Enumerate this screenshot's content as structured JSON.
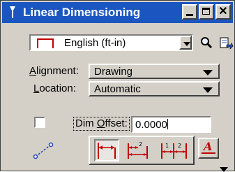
{
  "window": {
    "title": "Linear Dimensioning"
  },
  "titlebar": {
    "app_icon": "dimension-tool-icon",
    "minimize_icon": "minimize-icon",
    "maximize_icon": "maximize-icon",
    "close_glyph": "✕"
  },
  "units": {
    "selected": "English (ft-in)",
    "icon": "unit-bracket-icon",
    "search_icon": "magnifier-icon",
    "import_icon": "import-settings-icon"
  },
  "alignment": {
    "label_u": "A",
    "label_rest": "lignment:",
    "value": "Drawing"
  },
  "location": {
    "label_u": "L",
    "label_rest": "ocation:",
    "value": "Automatic"
  },
  "dim_offset": {
    "checked": false,
    "label_pre": "Dim ",
    "label_u": "O",
    "label_rest": "ffset:",
    "value": "0.0000"
  },
  "tools": [
    {
      "name": "dimension-size-with-arrows-icon",
      "selected": true
    },
    {
      "name": "dimension-size-stacked-icon",
      "selected": false
    },
    {
      "name": "dimension-ordinate-icon",
      "selected": false
    }
  ],
  "colors": {
    "titlebar": "#1b56c0",
    "accent_red": "#c00000",
    "face": "#d4d0c8"
  }
}
